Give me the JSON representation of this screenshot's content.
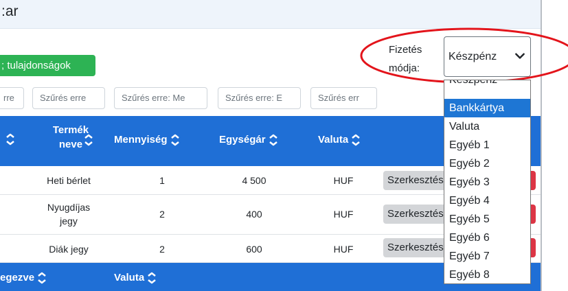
{
  "header": {
    "title_fragment": ":ar"
  },
  "green_button": {
    "label": "; tulajdonságok"
  },
  "payment": {
    "label_line1": "Fizetés",
    "label_line2": "módja:",
    "selected": "Készpénz",
    "options": [
      "Készpénz",
      "Bankkártya",
      "Valuta",
      "Egyéb 1",
      "Egyéb 2",
      "Egyéb 3",
      "Egyéb 4",
      "Egyéb 5",
      "Egyéb 6",
      "Egyéb 7",
      "Egyéb 8"
    ],
    "highlighted": "Bankkártya"
  },
  "filters": [
    "rre",
    "Szűrés erre",
    "Szűrés erre: Me",
    "Szűrés erre: E",
    "Szűrés err"
  ],
  "table": {
    "headers": {
      "product_line1": "Termék",
      "product_line2": "neve",
      "quantity": "Mennyiség",
      "unit_price": "Egységár",
      "currency": "Valuta"
    },
    "rows": [
      {
        "name_line1": "Heti bérlet",
        "name_line2": "",
        "quantity": "1",
        "unit_price": "4 500",
        "currency": "HUF",
        "edit": "Szerkesztés"
      },
      {
        "name_line1": "Nyugdíjas",
        "name_line2": "jegy",
        "quantity": "2",
        "unit_price": "400",
        "currency": "HUF",
        "edit": "Szerkesztés"
      },
      {
        "name_line1": "Diák jegy",
        "name_line2": "",
        "quantity": "2",
        "unit_price": "600",
        "currency": "HUF",
        "edit": "Szerkesztés"
      }
    ]
  },
  "footer_headers": {
    "completed": "egezve",
    "currency": "Valuta"
  },
  "colors": {
    "header_blue": "#1f6fd6",
    "green": "#2db354",
    "highlight": "#1e76d4",
    "annotation_red": "#e3141b",
    "delete_red": "#dc3545"
  }
}
